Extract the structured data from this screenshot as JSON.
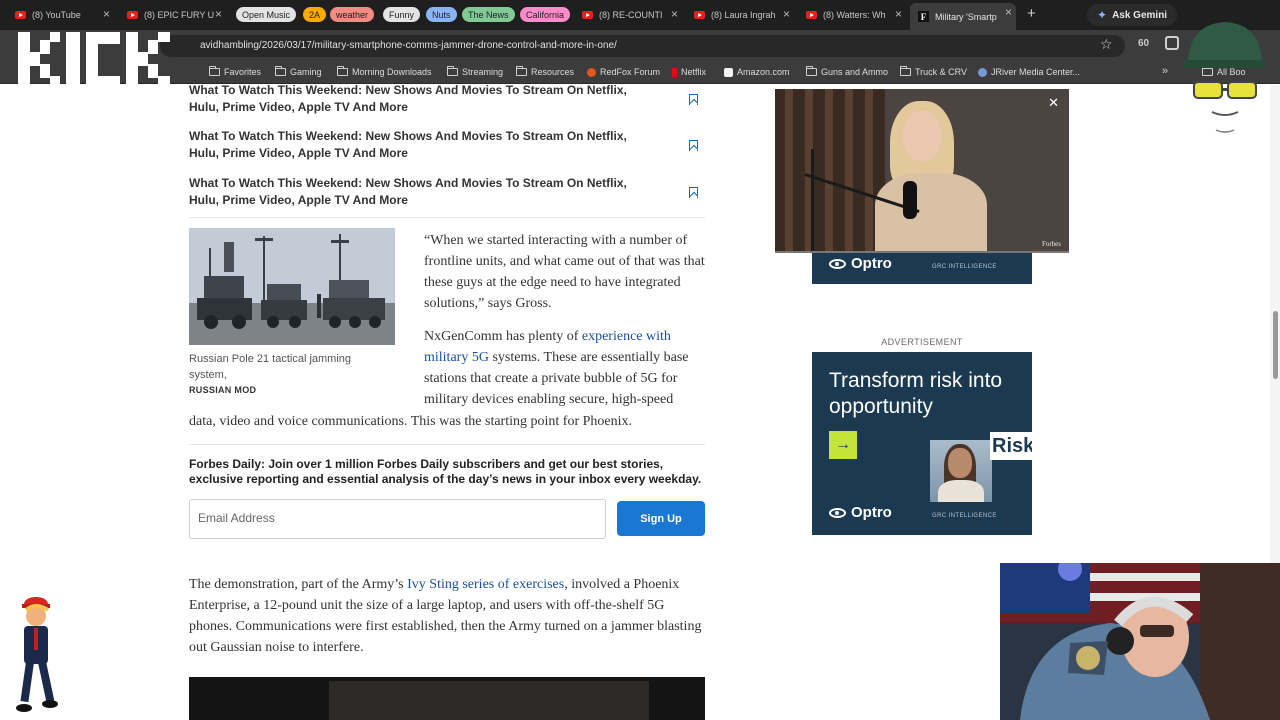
{
  "tabs": [
    {
      "label": "(8) YouTube",
      "icon": "youtube-icon"
    },
    {
      "label": "(8) EPIC FURY U",
      "icon": "youtube-icon"
    },
    {
      "label": "(8) RE-COUNTI",
      "icon": "youtube-icon"
    },
    {
      "label": "(8) Laura Ingrah",
      "icon": "youtube-icon"
    },
    {
      "label": "(8) Watters: Wh",
      "icon": "youtube-icon"
    },
    {
      "label": "Military 'Smartp",
      "icon": "forbes-icon",
      "active": true
    }
  ],
  "tab_groups": [
    {
      "label": "Open Music",
      "color": "#e3e3e3"
    },
    {
      "label": "2A",
      "color": "#f9ab00"
    },
    {
      "label": "weather",
      "color": "#f28b82"
    },
    {
      "label": "Funny",
      "color": "#e3e3e3"
    },
    {
      "label": "Nuts",
      "color": "#8ab4f8"
    },
    {
      "label": "The News",
      "color": "#81c995"
    },
    {
      "label": "California",
      "color": "#ff8bcb"
    }
  ],
  "gemini_label": "Ask Gemini",
  "address_bar": {
    "url": "avidhambling/2026/03/17/military-smartphone-comms-jammer-drone-control-and-more-in-one/",
    "counter": "60"
  },
  "bookmarks": [
    {
      "label": "Favorites",
      "icon": "folder-icon"
    },
    {
      "label": "Gaming",
      "icon": "folder-icon"
    },
    {
      "label": "Morning Downloads",
      "icon": "folder-icon"
    },
    {
      "label": "Streaming",
      "icon": "folder-icon"
    },
    {
      "label": "Resources",
      "icon": "folder-icon"
    },
    {
      "label": "RedFox Forum",
      "icon": "redfox-icon"
    },
    {
      "label": "Netflix",
      "icon": "netflix-icon"
    },
    {
      "label": "Amazon.com",
      "icon": "amazon-icon"
    },
    {
      "label": "Guns and Ammo",
      "icon": "folder-icon"
    },
    {
      "label": "Truck & CRV",
      "icon": "folder-icon"
    },
    {
      "label": "JRiver Media Center...",
      "icon": "jriver-icon"
    },
    {
      "label": "All Boo",
      "icon": "folder-icon"
    }
  ],
  "article": {
    "related_items": [
      "What To Watch This Weekend: New Shows And Movies To Stream On Netflix, Hulu, Prime Video, Apple TV And More",
      "What To Watch This Weekend: New Shows And Movies To Stream On Netflix, Hulu, Prime Video, Apple TV And More",
      "What To Watch This Weekend: New Shows And Movies To Stream On Netflix, Hulu, Prime Video, Apple TV And More"
    ],
    "image_caption": "Russian Pole 21 tactical jamming system,",
    "image_credit": "RUSSIAN MOD",
    "quote_paragraph": "“When we started interacting with a number of frontline units, and what came out of that was that these guys at the edge need to have integrated solutions,” says Gross.",
    "para2_before_link": "NxGenComm has plenty of ",
    "para2_link": "experience with military 5G",
    "para2_after_link_line": " systems. These are essentially base stations that create a private bubble of 5G for military devices enabling secure, high-speed",
    "para2_tail": "data, video and voice communications. This was the starting point for Phoenix.",
    "newsletter_text": "Forbes Daily: Join over 1 million Forbes Daily subscribers and get our best stories, exclusive reporting and essential analysis of the day’s news in your inbox every weekday.",
    "email_placeholder": "Email Address",
    "signup_label": "Sign Up",
    "para3_before_link": "The demonstration, part of the Army’s ",
    "para3_link": "Ivy Sting series of exercises",
    "para3_after_link": ", involved a Phoenix Enterprise, a 12-pound unit the size of a large laptop, and users with off-the-shelf 5G phones. Communications were first established, then the Army turned on a jammer blasting out Gaussian noise to interfere."
  },
  "ads": {
    "advertisement_label": "ADVERTISEMENT",
    "brand": "Optro",
    "brand_tagline": "GRC INTELLIGENCE",
    "headline": "Transform risk into opportunity",
    "risk_word": "Risk",
    "accent_color": "#c6e33a",
    "background_color": "#1b3a52"
  },
  "floating_video": {
    "watermark": "Forbes",
    "close_glyph": "✕"
  },
  "colors": {
    "link": "#1a4f9c",
    "signup_button": "#1a77d2",
    "bookmark_icon": "#1565c0"
  }
}
